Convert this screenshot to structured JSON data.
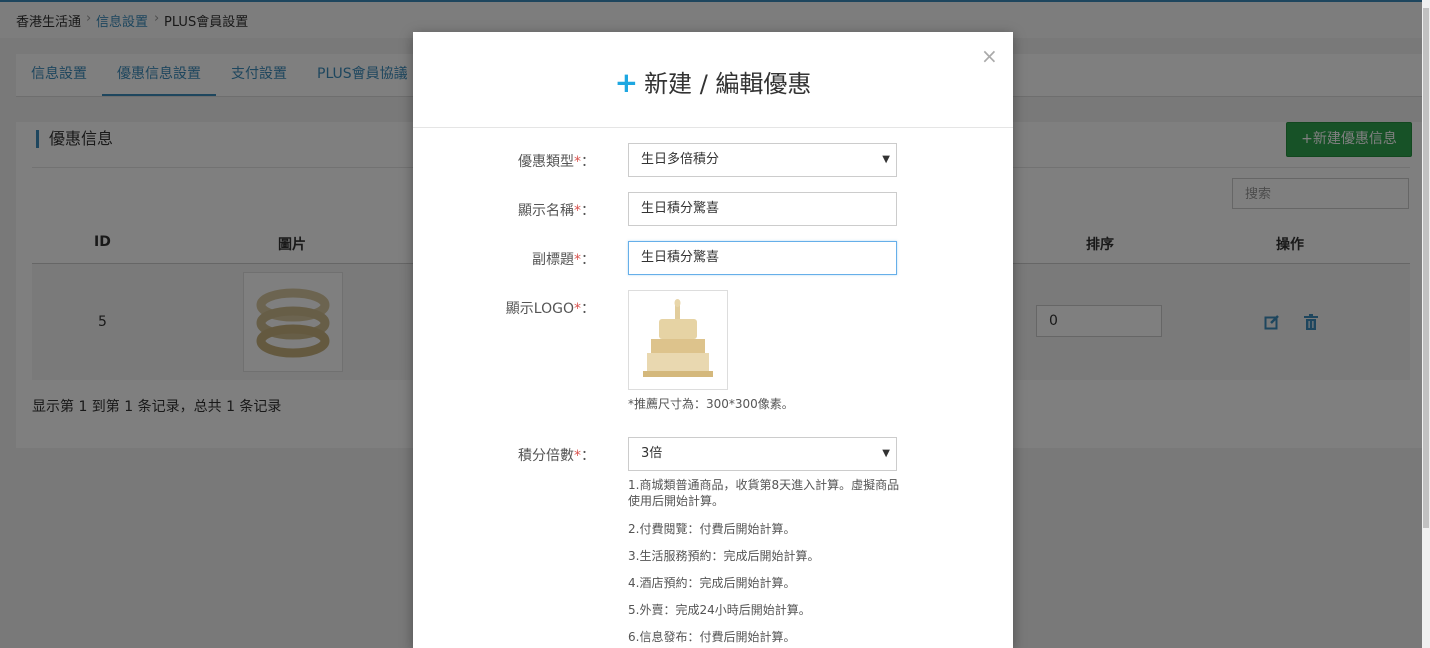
{
  "breadcrumb": {
    "home": "香港生活通",
    "level2": "信息設置",
    "level3": "PLUS會員設置"
  },
  "tabs": [
    {
      "label": "信息設置"
    },
    {
      "label": "優惠信息設置"
    },
    {
      "label": "支付設置"
    },
    {
      "label": "PLUS會員協議"
    }
  ],
  "panel": {
    "title": "優惠信息",
    "new_button": "+新建優惠信息",
    "search_placeholder": "搜索"
  },
  "table": {
    "headers": {
      "id": "ID",
      "image": "圖片",
      "sort": "排序",
      "actions": "操作"
    },
    "rows": [
      {
        "id": "5",
        "sort": "0"
      }
    ],
    "footer": "显示第 1 到第 1 条记录，总共 1 条记录"
  },
  "modal": {
    "title_icon": "+",
    "title": "新建 / 編輯優惠",
    "close": "×",
    "fields": {
      "type": {
        "label": "優惠類型",
        "value": "生日多倍積分"
      },
      "name": {
        "label": "顯示名稱",
        "value": "生日積分驚喜"
      },
      "subtitle": {
        "label": "副標題",
        "value": "生日積分驚喜"
      },
      "logo": {
        "label": "顯示LOGO",
        "hint": "*推薦尺寸為：300*300像素。"
      },
      "multiplier": {
        "label": "積分倍數",
        "value": "3倍"
      }
    },
    "required_mark": "*",
    "colon": "：",
    "notes": [
      "1.商城類普通商品，收貨第8天進入計算。虛擬商品使用后開始計算。",
      "2.付費閱覽：付費后開始計算。",
      "3.生活服務預約：完成后開始計算。",
      "4.酒店預約：完成后開始計算。",
      "5.外賣：完成24小時后開始計算。",
      "6.信息發布：付費后開始計算。"
    ]
  },
  "colors": {
    "accent": "#3c8dbc",
    "success": "#2ea44f",
    "required": "#d9534f",
    "modal_icon": "#1ea7e1"
  },
  "icons": {
    "edit": "edit-icon",
    "delete": "trash-icon",
    "close": "close-icon",
    "dropdown": "chevron-down-icon"
  }
}
